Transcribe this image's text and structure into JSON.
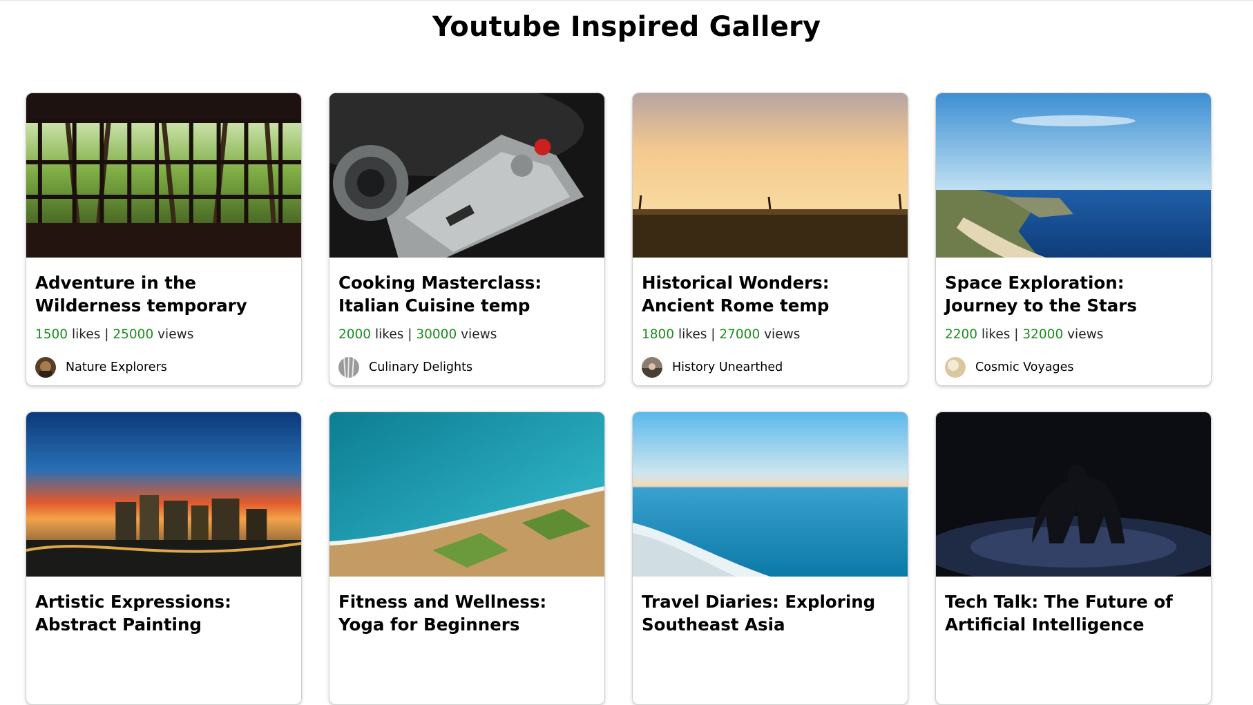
{
  "header": {
    "title": "Youtube Inspired Gallery"
  },
  "stat_words": {
    "likes": "likes",
    "views": "views",
    "sep": "|"
  },
  "videos": [
    {
      "title": "Adventure in the Wilderness temporary",
      "likes": "1500",
      "views": "25000",
      "channel": "Nature Explorers",
      "thumbnail": "forest-window-thumbnail"
    },
    {
      "title": "Cooking Masterclass: Italian Cuisine temp",
      "likes": "2000",
      "views": "30000",
      "channel": "Culinary Delights",
      "thumbnail": "camera-thumbnail"
    },
    {
      "title": "Historical Wonders: Ancient Rome temp",
      "likes": "1800",
      "views": "27000",
      "channel": "History Unearthed",
      "thumbnail": "sunset-field-thumbnail"
    },
    {
      "title": "Space Exploration: Journey to the Stars",
      "likes": "2200",
      "views": "32000",
      "channel": "Cosmic Voyages",
      "thumbnail": "coastline-thumbnail"
    },
    {
      "title": "Artistic Expressions: Abstract Painting",
      "likes": "",
      "views": "",
      "channel": "",
      "thumbnail": "city-sunset-thumbnail"
    },
    {
      "title": "Fitness and Wellness: Yoga for Beginners",
      "likes": "",
      "views": "",
      "channel": "",
      "thumbnail": "aerial-coast-thumbnail"
    },
    {
      "title": "Travel Diaries: Exploring Southeast Asia",
      "likes": "",
      "views": "",
      "channel": "",
      "thumbnail": "ocean-cliff-thumbnail"
    },
    {
      "title": "Tech Talk: The Future of Artificial Intelligence",
      "likes": "",
      "views": "",
      "channel": "",
      "thumbnail": "silhouette-couple-thumbnail"
    }
  ]
}
